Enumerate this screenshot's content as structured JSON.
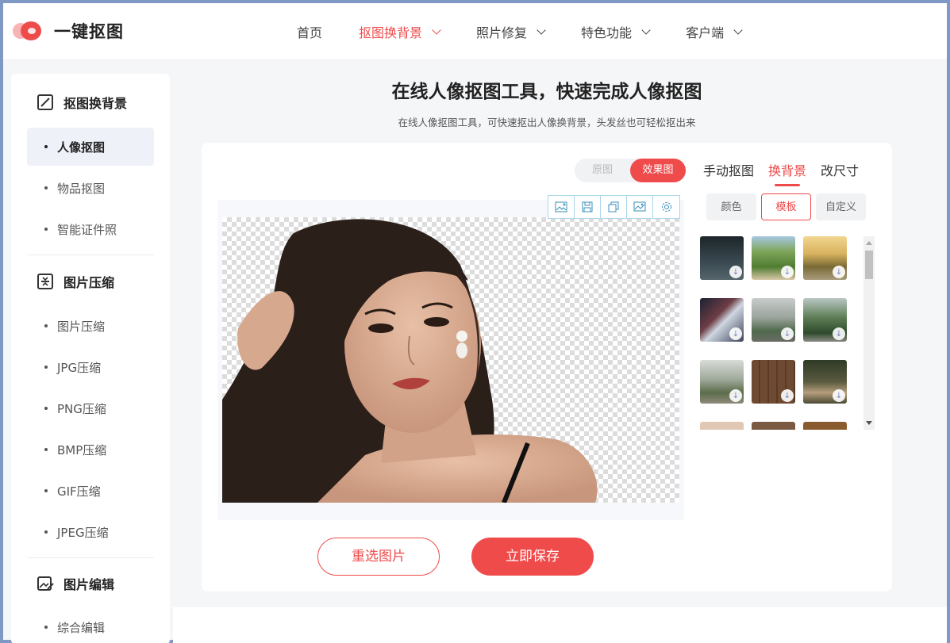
{
  "header": {
    "logo_text": "一键抠图",
    "nav": [
      {
        "label": "首页",
        "dropdown": false,
        "active": false
      },
      {
        "label": "抠图换背景",
        "dropdown": true,
        "active": true
      },
      {
        "label": "照片修复",
        "dropdown": true,
        "active": false
      },
      {
        "label": "特色功能",
        "dropdown": true,
        "active": false
      },
      {
        "label": "客户端",
        "dropdown": true,
        "active": false
      }
    ]
  },
  "sidebar": {
    "groups": [
      {
        "title": "抠图换背景",
        "icon": "cutout-icon",
        "items": [
          "人像抠图",
          "物品抠图",
          "智能证件照"
        ],
        "active_index": 0
      },
      {
        "title": "图片压缩",
        "icon": "compress-icon",
        "items": [
          "图片压缩",
          "JPG压缩",
          "PNG压缩",
          "BMP压缩",
          "GIF压缩",
          "JPEG压缩"
        ]
      },
      {
        "title": "图片编辑",
        "icon": "image-edit-icon",
        "items": [
          "综合编辑"
        ]
      }
    ]
  },
  "main": {
    "title": "在线人像抠图工具，快速完成人像抠图",
    "subtitle": "在线人像抠图工具，可快速抠出人像换背景，头发丝也可轻松抠出来",
    "toggle": {
      "original": "原图",
      "result": "效果图",
      "selected": "效果图"
    },
    "tools": [
      "add-image-icon",
      "save-icon",
      "copy-icon",
      "replace-image-icon",
      "settings-icon"
    ],
    "buttons": {
      "reselect": "重选图片",
      "save": "立即保存"
    }
  },
  "panel": {
    "tabs": [
      "手动抠图",
      "换背景",
      "改尺寸"
    ],
    "active_tab": "换背景",
    "subtabs": [
      "颜色",
      "模板",
      "自定义"
    ],
    "active_subtab": "模板",
    "thumbnails": [
      "dark-road",
      "green-field-road",
      "sunset-road",
      "aerial-river",
      "foggy-road",
      "forest-road",
      "misty-road",
      "wooden-planks",
      "deer",
      "partial-1",
      "partial-2",
      "partial-3"
    ]
  },
  "colors": {
    "accent": "#ef4b4b",
    "tool_border": "#a9d6ea"
  }
}
